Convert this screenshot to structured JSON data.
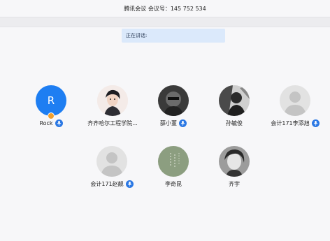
{
  "window": {
    "title": "腾讯会议  会议号：145 752 534"
  },
  "banner": {
    "speaking_label": "正在讲话:"
  },
  "participants_row1": [
    {
      "name": "Rock",
      "initial": "R",
      "avatar": "initial",
      "mic": true,
      "host": true
    },
    {
      "name": "齐齐哈尔工程学院...",
      "avatar": "illustration-man",
      "mic": false
    },
    {
      "name": "薛小董",
      "avatar": "dark-photo",
      "mic": true
    },
    {
      "name": "孙毓俊",
      "avatar": "bw-photo",
      "mic": false
    },
    {
      "name": "会计171李添旭",
      "avatar": "default-silhouette",
      "mic": true
    }
  ],
  "participants_row2": [
    {
      "name": "会计171赵靓",
      "avatar": "default-silhouette",
      "mic": true
    },
    {
      "name": "李奇昆",
      "avatar": "green-calligraphy",
      "mic": false
    },
    {
      "name": "齐宇",
      "avatar": "anime-photo",
      "mic": false
    }
  ],
  "colors": {
    "accent": "#1e7ef2",
    "mic": "#2b78e4",
    "banner": "#dbe9fb",
    "host_badge": "#f0a030"
  }
}
